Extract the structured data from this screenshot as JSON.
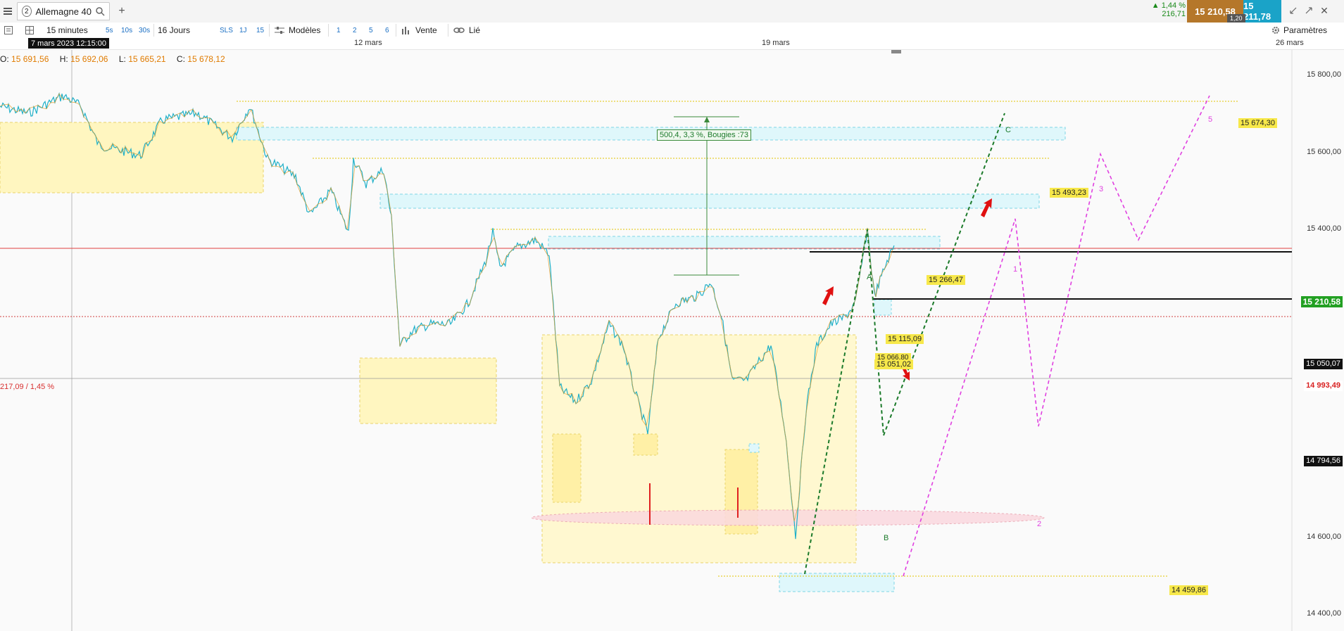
{
  "topbar": {
    "menu_icon": "hamburger-icon",
    "tab_number": "2",
    "tab_title": "Allemagne 40",
    "search_icon": "search-icon",
    "add_icon": "plus-icon",
    "change_pct": "▲ 1,44 %",
    "change_abs": "216,71",
    "bid": "15 210,58",
    "spread": "1,20",
    "ask": "15 211,78",
    "settings": "Paramètres"
  },
  "toolbar": {
    "interval": "15 minutes",
    "quick_intervals": [
      "5s",
      "10s",
      "30s"
    ],
    "period": "16 Jours",
    "sls": "SLS",
    "q1": "1J",
    "q2": "15",
    "models": "Modèles",
    "counts": [
      "1",
      "2",
      "5",
      "6"
    ],
    "sell": "Vente",
    "linked": "Lié"
  },
  "dates": {
    "cursor": "7 mars 2023 12:15:00",
    "d1": "12 mars",
    "d2": "19 mars",
    "d3": "26 mars"
  },
  "ohlc": {
    "o_label": "O:",
    "o": "15 691,56",
    "h_label": "H:",
    "h": "15 692,06",
    "l_label": "L:",
    "l": "15 665,21",
    "c_label": "C:",
    "c": "15 678,12"
  },
  "price_axis": [
    "15 800,00",
    "15 600,00",
    "15 400,00",
    "14 600,00",
    "14 400,00"
  ],
  "price_tags": {
    "current": "15 210,58",
    "level_black": "15 050,07",
    "prev_close": "14 993,49",
    "level_low": "14 794,56"
  },
  "chart_labels": {
    "left_change": "217,09 / 1,45 %",
    "measure": "500,4, 3,3 %, Bougies :73",
    "l1": "15 674,30",
    "l2": "15 493,23",
    "l3": "15 266,47",
    "l4": "15 115,09",
    "l5": "15 066,80",
    "l6": "15 051,02",
    "l7": "14 459,86",
    "wA": "A",
    "wB": "B",
    "wC": "C",
    "w1": "1",
    "w2": "2",
    "w3": "3",
    "w5": "5"
  },
  "colors": {
    "bid_bg": "#b5772a",
    "ask_bg": "#1aa3c8",
    "up": "#1aa3c8",
    "down": "#e08a00",
    "current": "#22a022",
    "zone_yellow": "#fff6c0",
    "zone_cyan": "#dff7fb"
  },
  "chart_data": {
    "type": "line",
    "x": [
      "7 mars 2023 12:15:00",
      "12 mars",
      "19 mars",
      "26 mars"
    ],
    "price_levels": [
      15800,
      15600,
      15400,
      14600,
      14400
    ],
    "current_price": 15210.58
  }
}
